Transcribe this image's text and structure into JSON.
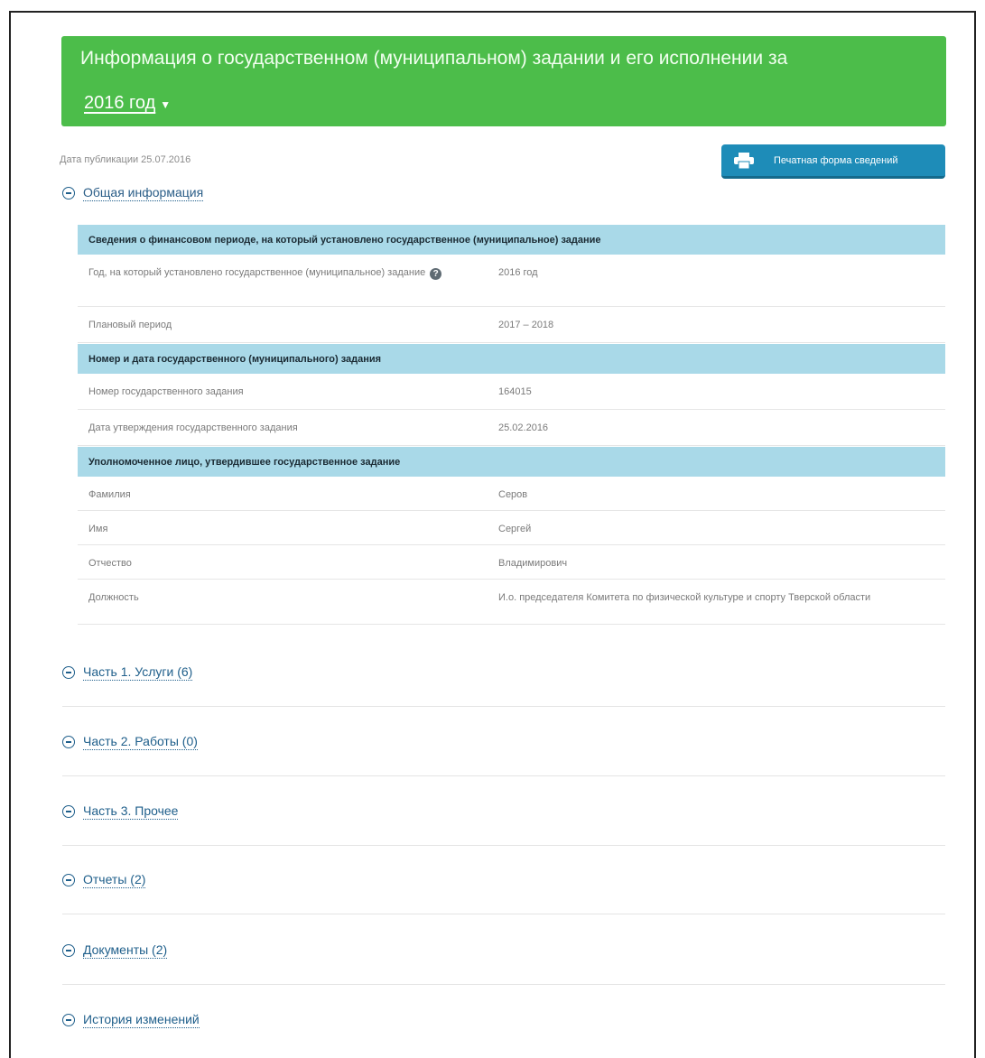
{
  "header": {
    "title": "Информация о государственном (муниципальном) задании и его исполнении за",
    "year": "2016 год"
  },
  "publication_date": "Дата публикации 25.07.2016",
  "print_button": {
    "label": "Печатная форма сведений"
  },
  "general_info": {
    "title": "Общая информация",
    "groups": [
      {
        "title": "Сведения о финансовом периоде, на который установлено государственное (муниципальное) задание",
        "rows": [
          {
            "key": "Год, на который установлено государственное (муниципальное) задание",
            "value": "2016 год"
          },
          {
            "key": "Плановый период",
            "value": "2017 – 2018"
          }
        ]
      },
      {
        "title": "Номер и дата государственного (муниципального) задания",
        "rows": [
          {
            "key": "Номер государственного задания",
            "value": "164015"
          },
          {
            "key": "Дата утверждения государственного задания",
            "value": "25.02.2016"
          }
        ]
      },
      {
        "title": "Уполномоченное лицо, утвердившее государственное задание",
        "rows": [
          {
            "key": "Фамилия",
            "value": "Серов"
          },
          {
            "key": "Имя",
            "value": "Сергей"
          },
          {
            "key": "Отчество",
            "value": "Владимирович"
          },
          {
            "key": "Должность",
            "value": "И.о. председателя Комитета по физической культуре и спорту Тверской области"
          }
        ]
      }
    ]
  },
  "sections": [
    {
      "label": "Часть 1. Услуги (6)"
    },
    {
      "label": "Часть 2. Работы (0)"
    },
    {
      "label": "Часть 3. Прочее"
    },
    {
      "label": "Отчеты (2)"
    },
    {
      "label": "Документы (2)"
    },
    {
      "label": "История изменений"
    }
  ]
}
